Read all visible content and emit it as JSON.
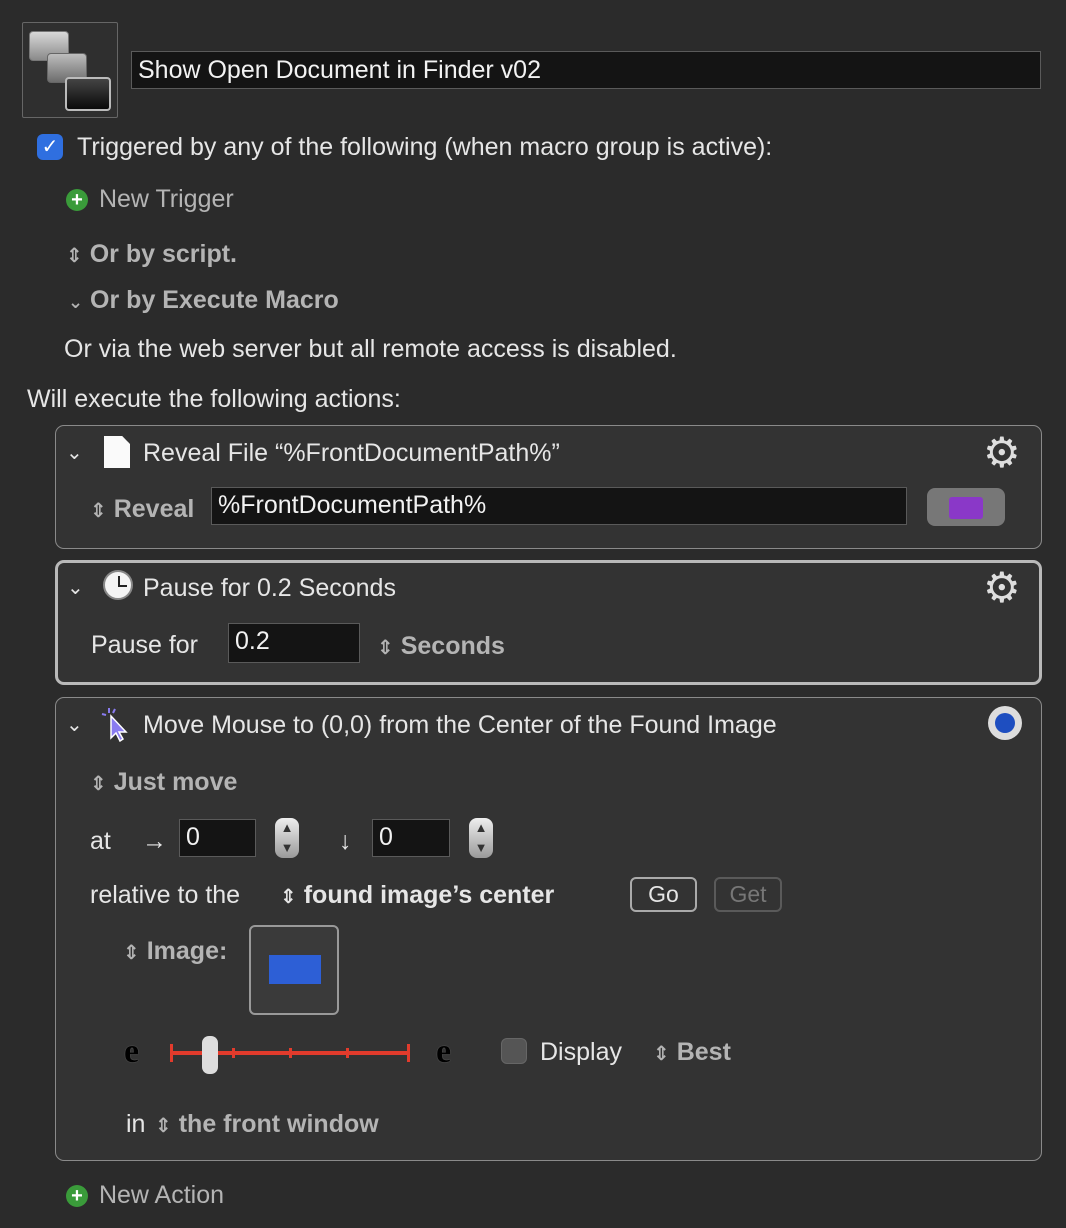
{
  "macro": {
    "name": "Show Open Document in Finder v02"
  },
  "triggers": {
    "heading": "Triggered by any of the following (when macro group is active):",
    "checkbox_checked": true,
    "new_trigger": "New Trigger",
    "or_by_script": "Or by script.",
    "or_by_execute_macro": "Or by Execute Macro",
    "web_server_note": "Or via the web server but all remote access is disabled."
  },
  "actions_heading": "Will execute the following actions:",
  "actions": [
    {
      "title": "Reveal File “%FrontDocumentPath%”",
      "mode_label": "Reveal",
      "path_value": "%FrontDocumentPath%"
    },
    {
      "title": "Pause for 0.2 Seconds",
      "pause_label": "Pause for",
      "pause_value": "0.2",
      "unit": "Seconds"
    },
    {
      "title": "Move Mouse to (0,0) from the Center of the Found Image",
      "mode": "Just move",
      "at_label": "at",
      "x_value": "0",
      "y_value": "0",
      "relative_label": "relative to the",
      "relative_value": "found image’s center",
      "go_button": "Go",
      "get_button": "Get",
      "image_label": "Image:",
      "fuzz_left_glyph": "e",
      "fuzz_right_glyph": "e",
      "fuzz_level": 0.1,
      "display_label": "Display",
      "display_checked": false,
      "quality": "Best",
      "in_label": "in",
      "in_value": "the front window"
    }
  ],
  "new_action": "New Action",
  "colors": {
    "background": "#2b2b2b",
    "panel": "#333333",
    "accent_blue": "#2f6fe0",
    "add_green": "#3a9b3a",
    "slider_red": "#e23b2c",
    "image_swatch": "#2d5fd6"
  },
  "icons": [
    "macro-icon",
    "checkbox-icon",
    "plus-icon",
    "updown-icon",
    "chevron-down-icon",
    "document-icon",
    "clock-icon",
    "cursor-sparkle-icon",
    "gear-icon",
    "folder-icon",
    "stepper-icon"
  ]
}
